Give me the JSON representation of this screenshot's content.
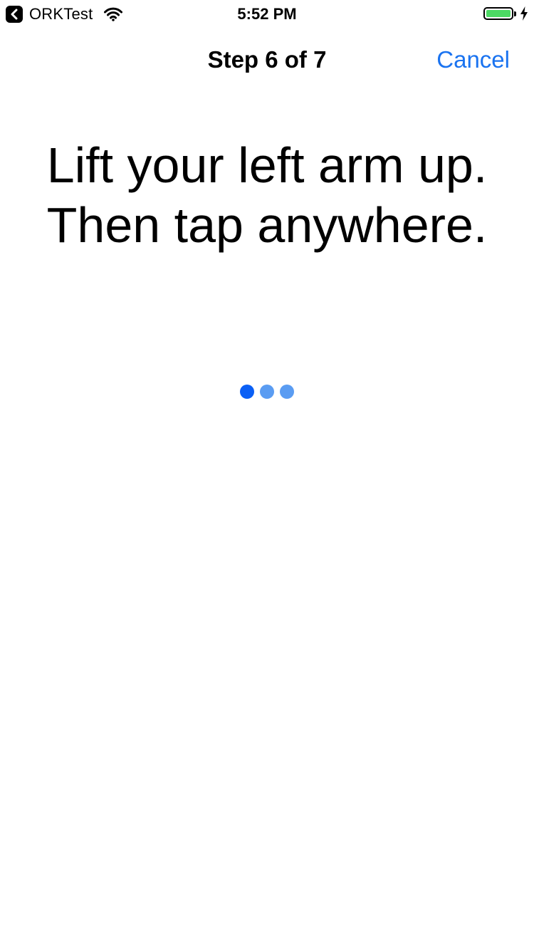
{
  "status_bar": {
    "back_app_label": "ORKTest",
    "time": "5:52 PM",
    "battery_level": 1.0,
    "charging": true,
    "icons": [
      "back-chevron-icon",
      "wifi-icon",
      "battery-icon",
      "charging-bolt-icon"
    ]
  },
  "nav": {
    "title": "Step 6 of 7",
    "cancel_label": "Cancel"
  },
  "instruction": {
    "line1": "Lift your left arm up.",
    "line2": "Then tap anywhere."
  },
  "activity_indicator": {
    "dots": [
      {
        "state": "active",
        "color": "#0a5ff5"
      },
      {
        "state": "inactive",
        "color": "#5a9cf2"
      },
      {
        "state": "inactive",
        "color": "#5a9cf2"
      }
    ]
  },
  "colors": {
    "accent": "#1a73f0",
    "battery": "#4cd964",
    "background": "#ffffff"
  }
}
